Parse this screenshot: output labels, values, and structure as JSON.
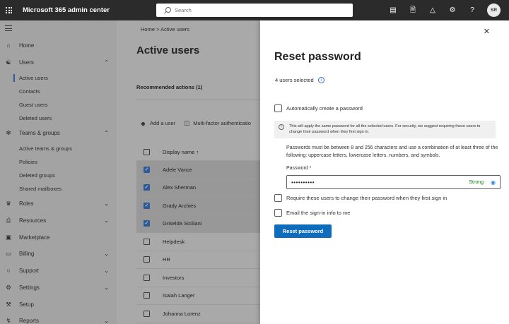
{
  "header": {
    "app_title": "Microsoft 365 admin center",
    "search_placeholder": "Search",
    "icons": [
      "monitor-icon",
      "document-icon",
      "bell-icon",
      "gear-icon",
      "help-icon"
    ],
    "avatar_initials": "SR"
  },
  "sidebar": {
    "items": [
      {
        "label": "Home",
        "icon": "home-icon"
      },
      {
        "label": "Users",
        "icon": "person-icon"
      },
      {
        "label": "Teams & groups",
        "icon": "group-icon"
      },
      {
        "label": "Roles",
        "icon": "roles-icon"
      },
      {
        "label": "Resources",
        "icon": "printer-icon"
      },
      {
        "label": "Marketplace",
        "icon": "bag-icon"
      },
      {
        "label": "Billing",
        "icon": "card-icon"
      },
      {
        "label": "Support",
        "icon": "headset-icon"
      },
      {
        "label": "Settings",
        "icon": "gear-icon"
      },
      {
        "label": "Setup",
        "icon": "wrench-icon"
      },
      {
        "label": "Reports",
        "icon": "chart-icon"
      }
    ],
    "users_sub": [
      "Active users",
      "Contacts",
      "Guest users",
      "Deleted users"
    ],
    "teams_sub": [
      "Active teams & groups",
      "Policies",
      "Deleted groups",
      "Shared mailboxes"
    ]
  },
  "main": {
    "breadcrumb": "Home  >  Active users",
    "title": "Active users",
    "recommended": "Recommended actions (1)",
    "add_user": "Add a user",
    "mfa": "Multi-factor authenticatio",
    "column_header": "Display name ↑",
    "rows": [
      {
        "name": "Adele Vance",
        "selected": true
      },
      {
        "name": "Alex Sherman",
        "selected": true
      },
      {
        "name": "Grady Archies",
        "selected": true
      },
      {
        "name": "Griselda Siciliani",
        "selected": true
      },
      {
        "name": "Helpdesk",
        "selected": false
      },
      {
        "name": "HR",
        "selected": false
      },
      {
        "name": "Investors",
        "selected": false
      },
      {
        "name": "Isaiah Langer",
        "selected": false
      },
      {
        "name": "Johanna Lorenz",
        "selected": false
      }
    ]
  },
  "panel": {
    "title": "Reset password",
    "selected_count": "4 users selected",
    "auto_create_label": "Automatically create a password",
    "warning": "This will apply the same password for all the selected users. For security, we suggest requiring these users to change their password when they first sign in.",
    "rules": "Passwords must be between 8 and 256 characters and use a combination of at least three of the following: uppercase letters, lowercase letters, numbers, and symbols.",
    "password_label": "Password *",
    "password_value": "••••••••••",
    "strength": "Strong",
    "require_change_label": "Require these users to change their password when they first sign in",
    "email_label": "Email the sign-in info to me",
    "reset_button": "Reset password"
  }
}
